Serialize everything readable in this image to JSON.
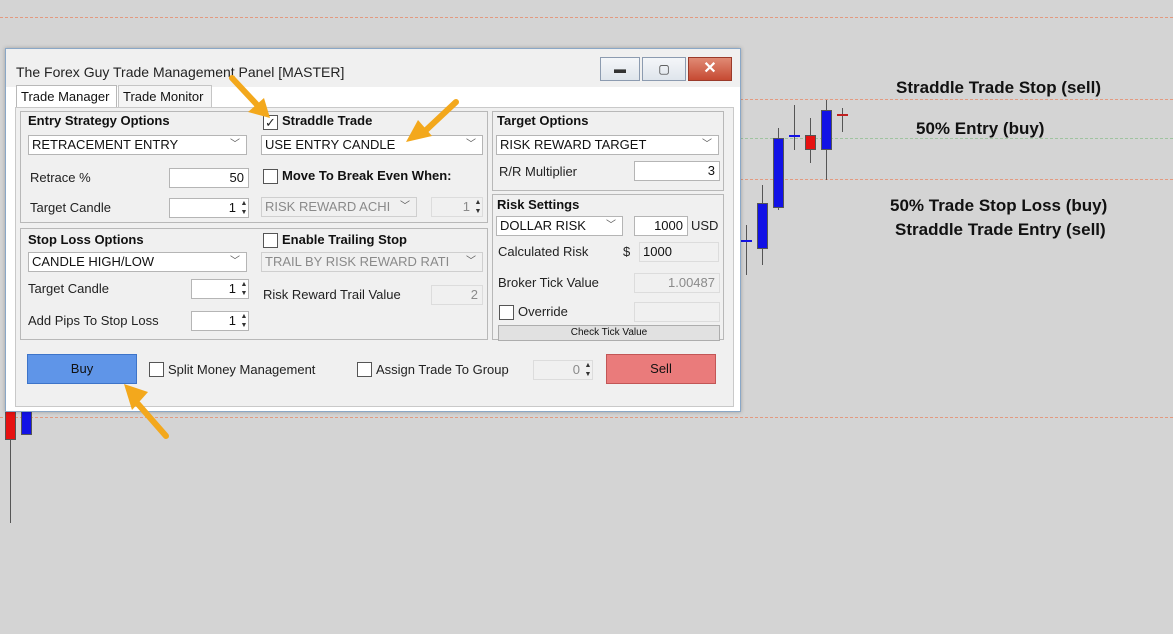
{
  "window": {
    "title": "The Forex Guy Trade Management Panel [MASTER]",
    "minimize": "▬",
    "maximize": "▢",
    "close": "✕"
  },
  "tabs": [
    {
      "label": "Trade Manager",
      "active": true
    },
    {
      "label": "Trade Monitor",
      "active": false
    }
  ],
  "entry_strategy": {
    "heading": "Entry Strategy Options",
    "selected": "RETRACEMENT ENTRY",
    "retrace_label": "Retrace %",
    "retrace_value": "50",
    "target_candle_label": "Target Candle",
    "target_candle_value": "1"
  },
  "straddle": {
    "label": "Straddle Trade",
    "checked": true,
    "selected": "USE ENTRY CANDLE",
    "break_even_label": "Move To Break Even When:",
    "break_even_select": "RISK REWARD ACHI",
    "break_even_value": "1"
  },
  "target_options": {
    "heading": "Target Options",
    "selected": "RISK REWARD TARGET",
    "multiplier_label": "R/R Multiplier",
    "multiplier_value": "3"
  },
  "stop_loss": {
    "heading": "Stop Loss Options",
    "selected": "CANDLE HIGH/LOW",
    "target_candle_label": "Target Candle",
    "target_candle_value": "1",
    "add_pips_label": "Add Pips To Stop Loss",
    "add_pips_value": "1"
  },
  "trailing": {
    "label": "Enable Trailing Stop",
    "selected": "TRAIL BY RISK REWARD RATI",
    "trail_value_label": "Risk Reward Trail Value",
    "trail_value": "2"
  },
  "risk": {
    "heading": "Risk Settings",
    "selected": "DOLLAR RISK",
    "amount": "1000",
    "currency": "USD",
    "calculated_label": "Calculated Risk",
    "dollar_sign": "$",
    "calculated_value": "1000",
    "tick_label": "Broker Tick Value",
    "tick_value": "1.00487",
    "override_label": "Override",
    "check_tick_button": "Check Tick Value"
  },
  "bottom": {
    "buy": "Buy",
    "split_label": "Split Money Management",
    "assign_label": "Assign Trade To Group",
    "group_value": "0",
    "sell": "Sell"
  },
  "annotations": {
    "straddle_stop": "Straddle Trade Stop (sell)",
    "entry_50": "50% Entry (buy)",
    "stop_loss_50": "50% Trade Stop Loss (buy)",
    "straddle_entry": "Straddle Trade Entry (sell)"
  },
  "colors": {
    "buy_button": "#5f95e8",
    "sell_button": "#ea7b7b",
    "bull_candle": "#1212e6",
    "bear_candle": "#e61212",
    "arrow": "#f3a81c"
  }
}
